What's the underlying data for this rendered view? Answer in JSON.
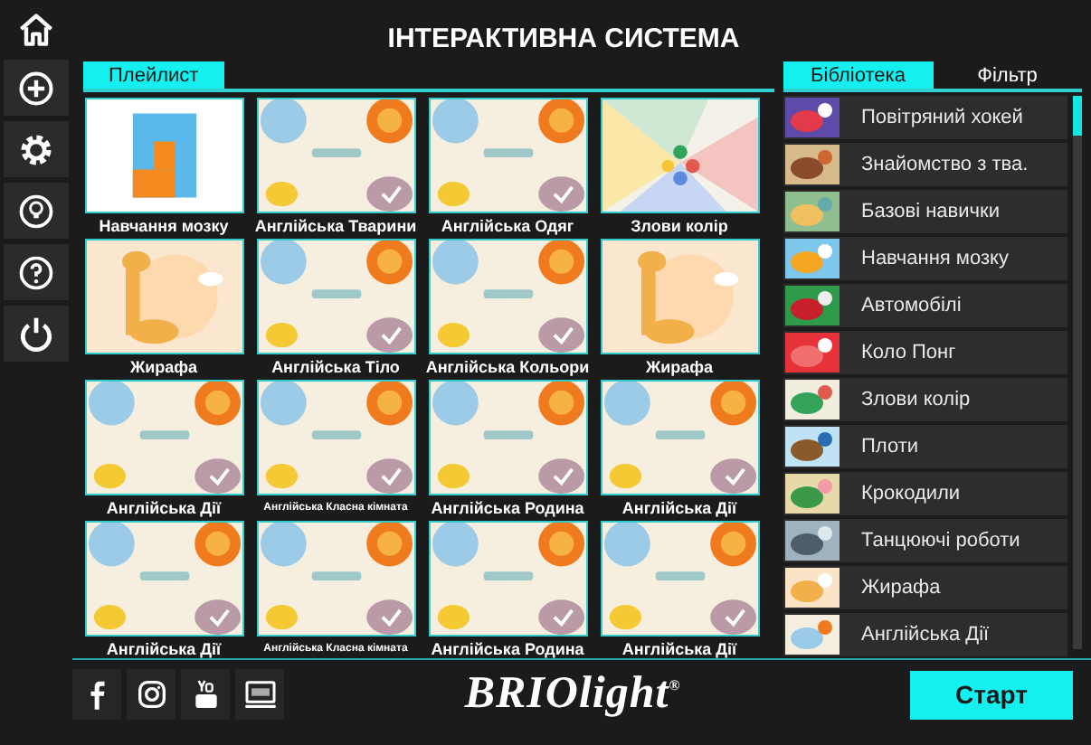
{
  "title": "ІНТЕРАКТИВНА СИСТЕМА",
  "sidebar": {
    "buttons": [
      {
        "kind": "home"
      },
      {
        "kind": "add"
      },
      {
        "kind": "settings"
      },
      {
        "kind": "tips"
      },
      {
        "kind": "help"
      },
      {
        "kind": "power"
      }
    ]
  },
  "playlist_tabs": [
    {
      "label": "Плейлист",
      "selected": true
    }
  ],
  "playlist": [
    {
      "label": "Навчання мозку"
    },
    {
      "label": "Англійська Тварини"
    },
    {
      "label": "Англійська Одяг"
    },
    {
      "label": "Злови колір"
    },
    {
      "label": "Жирафа"
    },
    {
      "label": "Англійська Тіло"
    },
    {
      "label": "Англійська Кольори"
    },
    {
      "label": "Жирафа"
    },
    {
      "label": "Англійська Дії"
    },
    {
      "label": "Англійська Класна кімната",
      "small": true
    },
    {
      "label": "Англійська Родина"
    },
    {
      "label": "Англійська Дії"
    },
    {
      "label": "Англійська Дії"
    },
    {
      "label": "Англійська Класна кімната",
      "small": true
    },
    {
      "label": "Англійська Родина"
    },
    {
      "label": "Англійська Дії"
    }
  ],
  "library_tabs": [
    {
      "label": "Бібліотека",
      "selected": true
    },
    {
      "label": "Фільтр",
      "selected": false
    }
  ],
  "library": [
    "Повітряний хокей",
    "Знайомство з тва.",
    "Базові навички",
    "Навчання мозку",
    "Автомобілі",
    "Коло Понг",
    "Злови колір",
    "Плоти",
    "Крокодили",
    "Танцюючі роботи",
    "Жирафа",
    "Англійська Дії"
  ],
  "footer": {
    "social": [
      {
        "kind": "facebook"
      },
      {
        "kind": "instagram"
      },
      {
        "kind": "youtube"
      },
      {
        "kind": "www"
      }
    ],
    "logo": "BRIOlight$^{®}$",
    "start_button": "Старт"
  }
}
